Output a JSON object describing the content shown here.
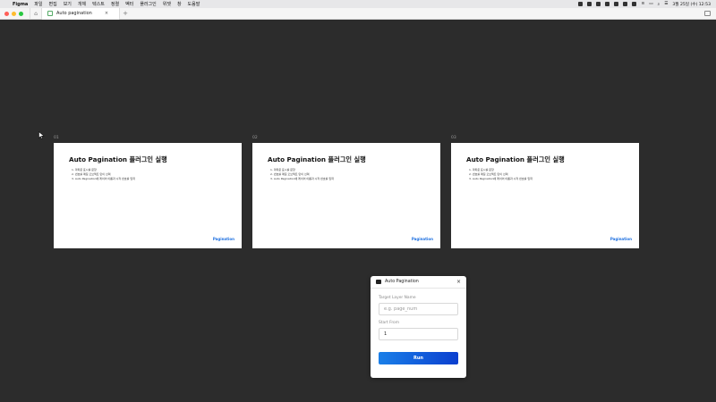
{
  "menubar": {
    "app_name": "Figma",
    "items": [
      "파일",
      "편집",
      "보기",
      "개체",
      "텍스트",
      "정렬",
      "벡터",
      "플러그인",
      "위젯",
      "창",
      "도움말"
    ],
    "clock": "3월 25일 (수) 12:53"
  },
  "tabbar": {
    "tab_title": "Auto pagination",
    "new_tab": "+"
  },
  "canvas": {
    "frames": [
      {
        "label": "01",
        "title": "Auto Pagination 플러그인 실행",
        "steps": [
          "1. 마파운 표시를 문항",
          "2. 번호를 매길 오브젝트 만이 선택",
          "3. Auto Pagination에 레이어 이름과 시작 번호를 입력"
        ],
        "pagination": "Pagination"
      },
      {
        "label": "02",
        "title": "Auto Pagination 플러그인 실행",
        "steps": [
          "1. 마파운 표시를 문항",
          "2. 번호를 매길 오브젝트 만이 선택",
          "3. Auto Pagination에 레이어 이름과 시작 번호를 입력"
        ],
        "pagination": "Pagination"
      },
      {
        "label": "03",
        "title": "Auto Pagination 플러그인 실행",
        "steps": [
          "1. 마파운 표시를 문항",
          "2. 번호를 매길 오브젝트 만이 선택",
          "3. Auto Pagination에 레이어 이름과 시작 번호를 입력"
        ],
        "pagination": "Pagination"
      }
    ]
  },
  "dialog": {
    "title": "Auto Pagination",
    "close": "×",
    "target_label": "Target Layer Name",
    "target_placeholder": "e.g. page_num",
    "start_label": "Start From",
    "start_value": "1",
    "run_label": "Run"
  },
  "colors": {
    "canvas_bg": "#2c2c2c",
    "accent": "#1c6fe0",
    "run_gradient_start": "#1a7fe8",
    "run_gradient_end": "#0b3fcf"
  }
}
